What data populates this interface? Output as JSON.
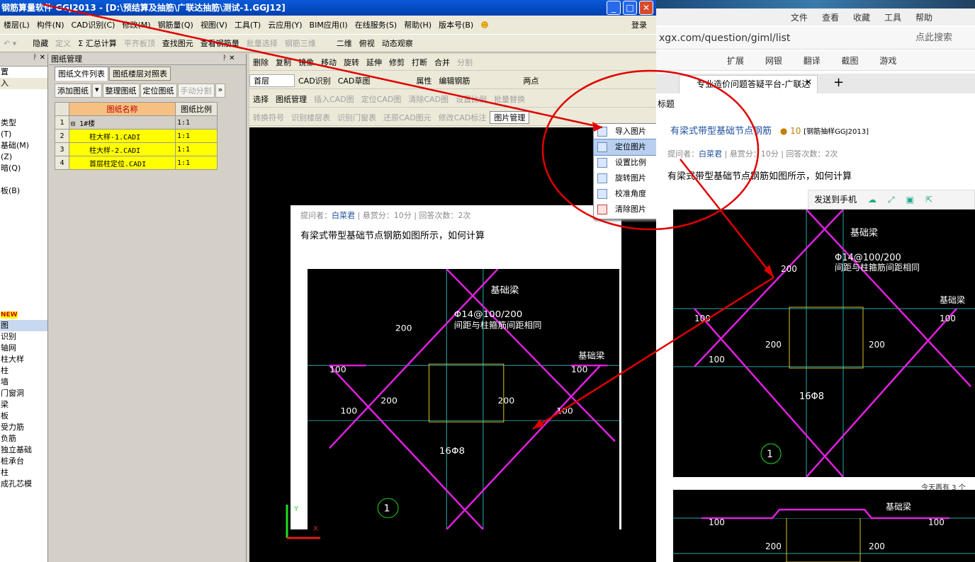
{
  "app": {
    "title": "钢筋算量软件 GGJ2013 - [D:\\预结算及抽筋\\广联达抽筋\\测试-1.GGJ12]",
    "menu": [
      "楼层(L)",
      "构件(N)",
      "CAD识别(C)",
      "修改(M)",
      "钢筋量(Q)",
      "视图(V)",
      "工具(T)",
      "云应用(Y)",
      "BIM应用(I)",
      "在线服务(S)",
      "帮助(H)",
      "版本号(B)"
    ],
    "login": "登录",
    "toolbar1": [
      "隐藏",
      "定义",
      "Σ 汇总计算",
      "平齐板顶",
      "查找图元",
      "查看钢筋量",
      "批量选择",
      "钢筋三维",
      "二维",
      "俯视",
      "动态观察"
    ],
    "left_items": [
      "置",
      "入",
      "类型",
      "(T)",
      "基础(M)",
      "(Z)",
      "暗(Q)",
      "板(B)",
      "NEW",
      "图",
      "识别",
      "轴网",
      "柱大样",
      "柱",
      "墙",
      "门窗洞",
      "梁",
      "板",
      "受力筋",
      "负筋",
      "独立基础",
      "桩承台",
      "柱",
      "成孔芯模"
    ],
    "drawing_manager": {
      "title": "图纸管理",
      "tabs": [
        "图纸文件列表",
        "图纸楼层对照表"
      ],
      "buttons": [
        "添加图纸",
        "整理图纸",
        "定位图纸",
        "手动分割"
      ],
      "col_name": "图纸名称",
      "col_scale": "图纸比例",
      "rows": [
        {
          "n": "1",
          "name": "1#楼",
          "scale": "1:1"
        },
        {
          "n": "2",
          "name": "柱大样-1.CADI",
          "scale": "1:1"
        },
        {
          "n": "3",
          "name": "柱大样-2.CADI",
          "scale": "1:1"
        },
        {
          "n": "4",
          "name": "首层柱定位.CADI",
          "scale": "1:1"
        }
      ]
    },
    "toolbar_rows": [
      [
        "删除",
        "复制",
        "镜像",
        "移动",
        "旋转",
        "延伸",
        "修剪",
        "打断",
        "合并",
        "分割"
      ],
      [
        "首层",
        "CAD识别",
        "CAD草图",
        "属性",
        "编辑钢筋",
        "两点"
      ],
      [
        "选择",
        "图纸管理",
        "插入CAD图",
        "定位CAD图",
        "清除CAD图",
        "设置比例",
        "批量替换"
      ],
      [
        "转换符号",
        "识别楼层表",
        "识别门窗表",
        "还原CAD图元",
        "修改CAD标注",
        "图片管理"
      ]
    ],
    "picture_menu": [
      "导入图片",
      "定位图片",
      "设置比例",
      "旋转图片",
      "校准角度",
      "清除图片"
    ],
    "picture_menu_highlight": "定位图片"
  },
  "question": {
    "asker_label": "提问者：",
    "asker": "白菜君",
    "reward": "悬赏分：10分",
    "answers": "回答次数：2次",
    "text": "有梁式带型基础节点钢筋如图所示，如何计算",
    "title": "有梁式带型基础节点钢筋",
    "score": "10",
    "tag": "[钢筋抽样GGJ2013]"
  },
  "cad": {
    "beam_label": "基础梁",
    "rebar_note1": "Φ14@100/200",
    "rebar_note2": "间距与柱箍筋间距相同",
    "dims": [
      "200",
      "100",
      "200",
      "200",
      "200",
      "200",
      "100",
      "100",
      "100",
      "100"
    ],
    "bottom_bar": "16Φ8",
    "circle_no": "1"
  },
  "browser": {
    "menu": [
      "文件",
      "查看",
      "收藏",
      "工具",
      "帮助"
    ],
    "url": "xgx.com/question/giml/list",
    "search_placeholder": "点此搜索",
    "ext": [
      "扩展",
      "网银",
      "翻译",
      "截图",
      "游戏"
    ],
    "tab_title": "专业造价问题答疑平台-广联达",
    "side_label": "标题",
    "send_label": "发送到手机",
    "today": "今天再有 3 个"
  }
}
